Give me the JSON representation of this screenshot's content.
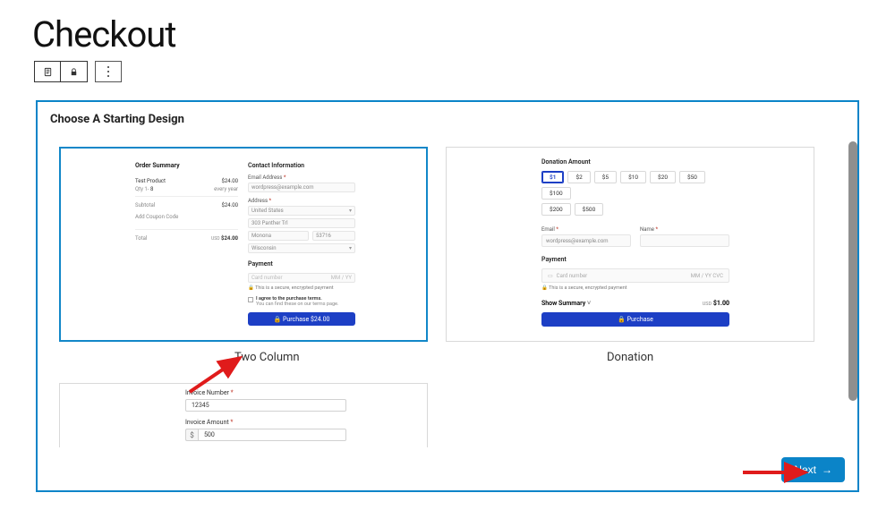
{
  "page": {
    "title": "Checkout"
  },
  "panel": {
    "heading": "Choose A Starting Design"
  },
  "templates": {
    "two_column": {
      "label": "Two Column",
      "left": {
        "heading": "Order Summary",
        "product_name": "Test Product",
        "qty_label": "Qty 1-",
        "qty_value": "8",
        "line_price": "$24.00",
        "recurrence": "every year",
        "subtotal_label": "Subtotal",
        "subtotal_value": "$24.00",
        "coupon_label": "Add Coupon Code",
        "total_label": "Total",
        "total_currency": "USD",
        "total_value": "$24.00"
      },
      "right": {
        "heading": "Contact Information",
        "email_label": "Email Address",
        "email_value": "wordpress@example.com",
        "address_label": "Address",
        "country": "United States",
        "street": "303 Panther Trl",
        "city": "Monona",
        "zip": "53716",
        "state": "Wisconsin",
        "payment_label": "Payment",
        "card_placeholder": "Card number",
        "card_exp": "MM / YY",
        "secure_note": "This is a secure, encrypted payment",
        "agree_text": "I agree to the purchase terms.",
        "agree_sub": "You can find these on our terms page.",
        "purchase_btn": "Purchase $24.00"
      }
    },
    "donation": {
      "label": "Donation",
      "section_title": "Donation Amount",
      "amounts": [
        "$1",
        "$2",
        "$5",
        "$10",
        "$20",
        "$50",
        "$100",
        "$200",
        "$500"
      ],
      "selected_index": 0,
      "email_label": "Email",
      "email_value": "wordpress@example.com",
      "name_label": "Name",
      "payment_label": "Payment",
      "card_placeholder": "Card number",
      "card_meta": "MM / YY  CVC",
      "secure_note": "This is a secure, encrypted payment",
      "summary_label": "Show Summary",
      "total_currency": "USD",
      "total_value": "$1.00",
      "purchase_btn": "Purchase"
    },
    "invoice": {
      "num_label": "Invoice Number",
      "num_value": "12345",
      "amt_label": "Invoice Amount",
      "amt_value": "500"
    }
  },
  "footer": {
    "next": "Next"
  }
}
